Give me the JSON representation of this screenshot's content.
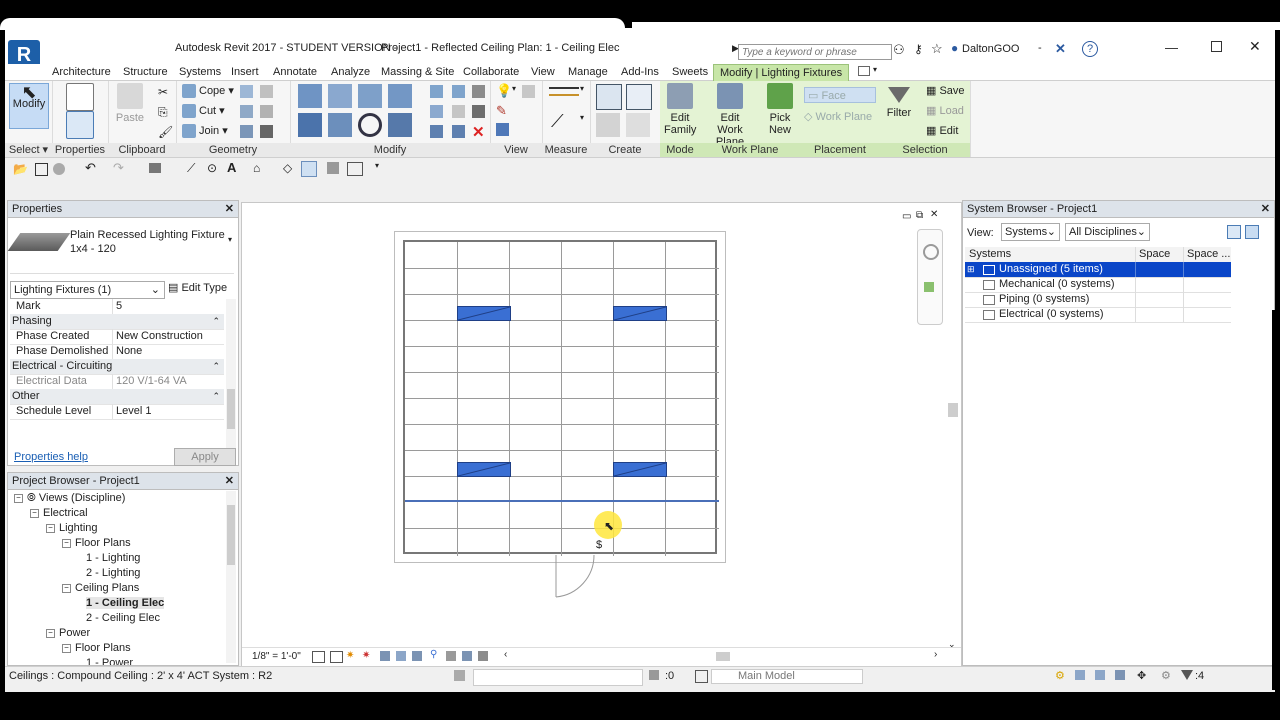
{
  "app": {
    "logo_letter": "R",
    "title_app": "Autodesk Revit 2017 - STUDENT VERSION -",
    "title_doc": "Project1 - Reflected Ceiling Plan: 1 - Ceiling Elec",
    "search_placeholder": "Type a keyword or phrase",
    "user": "DaltonGOO",
    "help": "?"
  },
  "ribbon_tabs": [
    "Architecture",
    "Structure",
    "Systems",
    "Insert",
    "Annotate",
    "Analyze",
    "Massing & Site",
    "Collaborate",
    "View",
    "Manage",
    "Add-Ins",
    "Sweets",
    "Modify | Lighting Fixtures"
  ],
  "ribbon": {
    "modify_label": "Modify",
    "select_group": "Select",
    "properties_group": "Properties",
    "clipboard_group": "Clipboard",
    "paste_label": "Paste",
    "geometry_group": "Geometry",
    "cope_label": "Cope",
    "cut_label": "Cut",
    "join_label": "Join",
    "modify_group": "Modify",
    "view_group": "View",
    "measure_group": "Measure",
    "create_group": "Create",
    "edit_family_1": "Edit",
    "edit_family_2": "Family",
    "mode_group": "Mode",
    "edit_wp_1": "Edit",
    "edit_wp_2": "Work Plane",
    "pick_new_1": "Pick",
    "pick_new_2": "New",
    "work_plane_group": "Work Plane",
    "face_label": "Face",
    "work_plane_label": "Work Plane",
    "placement_group": "Placement",
    "filter_label": "Filter",
    "save_label": "Save",
    "load_label": "Load",
    "edit_label": "Edit",
    "selection_group": "Selection"
  },
  "properties": {
    "title": "Properties",
    "type_name": "Plain Recessed Lighting Fixture",
    "type_size": "1x4 - 120",
    "selector": "Lighting Fixtures (1)",
    "edit_type": "Edit Type",
    "rows": [
      {
        "k": "Mark",
        "v": "5",
        "cat": false
      },
      {
        "k": "Phasing",
        "v": "",
        "cat": true
      },
      {
        "k": "Phase Created",
        "v": "New Construction",
        "cat": false
      },
      {
        "k": "Phase Demolished",
        "v": "None",
        "cat": false
      },
      {
        "k": "Electrical - Circuiting",
        "v": "",
        "cat": true
      },
      {
        "k": "Electrical Data",
        "v": "120 V/1-64 VA",
        "cat": false
      },
      {
        "k": "Other",
        "v": "",
        "cat": true
      },
      {
        "k": "Schedule Level",
        "v": "Level 1",
        "cat": false
      }
    ],
    "help_link": "Properties help",
    "apply": "Apply"
  },
  "project_browser": {
    "title": "Project Browser - Project1",
    "items": [
      {
        "label": "Views (Discipline)",
        "level": 0
      },
      {
        "label": "Electrical",
        "level": 1
      },
      {
        "label": "Lighting",
        "level": 2
      },
      {
        "label": "Floor Plans",
        "level": 3
      },
      {
        "label": "1 - Lighting",
        "level": 4
      },
      {
        "label": "2 - Lighting",
        "level": 4
      },
      {
        "label": "Ceiling Plans",
        "level": 3
      },
      {
        "label": "1 - Ceiling Elec",
        "level": 4
      },
      {
        "label": "2 - Ceiling Elec",
        "level": 4
      },
      {
        "label": "Power",
        "level": 2
      },
      {
        "label": "Floor Plans",
        "level": 3
      },
      {
        "label": "1 - Power",
        "level": 4
      }
    ]
  },
  "view_bar": {
    "scale": "1/8\" = 1'-0\""
  },
  "system_browser": {
    "title": "System Browser - Project1",
    "view_label": "View:",
    "view_select": "Systems",
    "discipline_select": "All Disciplines",
    "col_systems": "Systems",
    "col_space1": "Space ...",
    "col_space2": "Space ...",
    "rows": [
      "Unassigned (5 items)",
      "Mechanical (0 systems)",
      "Piping (0 systems)",
      "Electrical (0 systems)"
    ]
  },
  "status": {
    "text": "Ceilings : Compound Ceiling : 2' x 4' ACT System : R2",
    "count": ":0",
    "model": "Main Model",
    "filter_count": ":4"
  },
  "colors": {
    "accent_green": "#c8e6a8",
    "fixture_blue": "#3a6fd3",
    "selection_blue": "#0a46c8"
  }
}
